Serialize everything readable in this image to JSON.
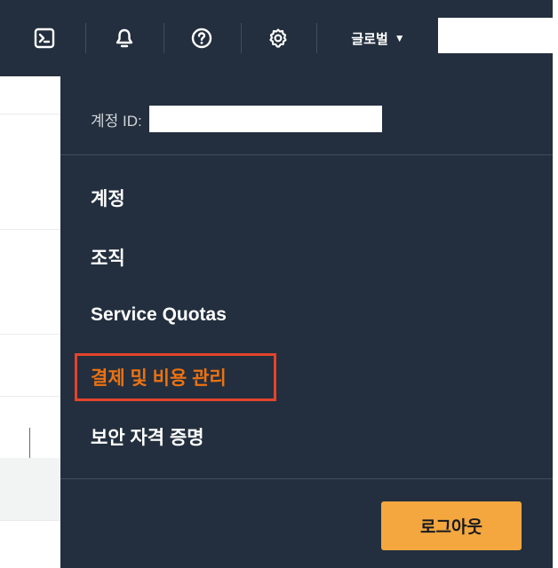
{
  "topbar": {
    "icons": [
      "cloudshell-icon",
      "bell-icon",
      "help-icon",
      "gear-icon"
    ],
    "region_label": "글로벌",
    "region_caret": "▼"
  },
  "menu": {
    "account_id_label": "계정 ID:",
    "items": [
      {
        "label": "계정"
      },
      {
        "label": "조직"
      },
      {
        "label": "Service Quotas"
      },
      {
        "label": "결제 및 비용 관리"
      },
      {
        "label": "보안 자격 증명"
      }
    ],
    "logout_label": "로그아웃"
  },
  "colors": {
    "nav_bg": "#232f3e",
    "accent_orange": "#ec7211",
    "button_bg": "#f3a73e",
    "highlight_border": "#e4442a"
  }
}
